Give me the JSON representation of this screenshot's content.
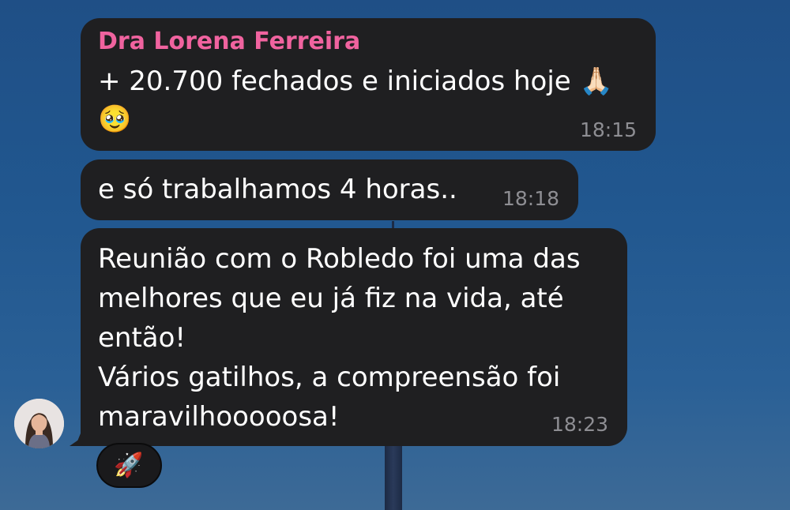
{
  "chat": {
    "messages": [
      {
        "sender": "Dra Lorena Ferreira",
        "line1": "+ 20.700 fechados e iniciados hoje",
        "emoji1": "🙏🏻",
        "emoji2": "🥹",
        "time": "18:15"
      },
      {
        "text": "e só trabalhamos 4 horas..",
        "time": "18:18"
      },
      {
        "lines": [
          "Reunião com o Robledo foi uma das",
          "melhores que eu já fiz na vida, até",
          "então!",
          "Vários gatilhos, a compreensão foi",
          "maravilhooooosa!"
        ],
        "time": "18:23"
      }
    ],
    "reaction": {
      "emoji": "🚀",
      "icon": "rocket-icon"
    },
    "avatar": {
      "icon": "person-avatar"
    }
  },
  "colors": {
    "bubble": "#1f1f21",
    "sender_name": "#f0639f",
    "timestamp": "#8e8e93"
  }
}
